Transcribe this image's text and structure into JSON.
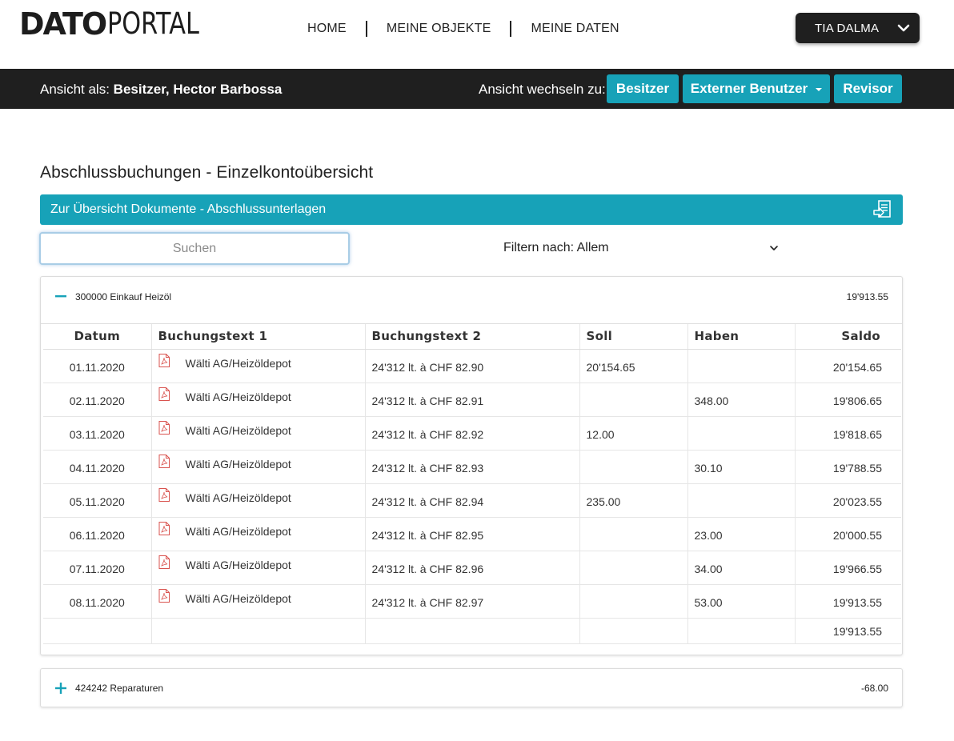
{
  "brand": {
    "logo_bold": "DATO",
    "logo_light": "PORTAL"
  },
  "nav": {
    "items": [
      {
        "label": "HOME"
      },
      {
        "label": "MEINE OBJEKTE"
      },
      {
        "label": "MEINE DATEN"
      }
    ]
  },
  "user": {
    "name": "TIA DALMA",
    "icon": "chevron-down-icon"
  },
  "viewbar": {
    "as_view_prefix": "Ansicht als:",
    "as_view_value": "Besitzer, Hector Barbossa",
    "switch_label": "Ansicht wechseln zu:",
    "buttons": [
      {
        "label": "Besitzer"
      },
      {
        "label": "Externer Benutzer"
      },
      {
        "label": "Revisor"
      }
    ]
  },
  "page": {
    "title": "Abschlussbuchungen - Einzelkontoübersicht",
    "doc_link": "Zur Übersicht Dokumente - Abschlussunterlagen",
    "doc_icon": "document-arrow-icon"
  },
  "search": {
    "placeholder": "Suchen",
    "value": ""
  },
  "filter": {
    "label": "Filtern nach: Allem"
  },
  "accent_color": "#17a2b8",
  "accounts": [
    {
      "name": "300000 Einkauf Heizöl",
      "total": "19'913.55",
      "expanded": true,
      "columns": [
        "Datum",
        "Buchungstext 1",
        "Buchungstext 2",
        "Soll",
        "Haben",
        "Saldo"
      ],
      "rows": [
        {
          "date": "01.11.2020",
          "text1": "Wälti AG/Heizöldepot",
          "text2": "24'312 lt. à CHF 82.90",
          "soll": "20'154.65",
          "haben": "",
          "saldo": "20'154.65"
        },
        {
          "date": "02.11.2020",
          "text1": "Wälti AG/Heizöldepot",
          "text2": "24'312 lt. à CHF 82.91",
          "soll": "",
          "haben": "348.00",
          "saldo": "19'806.65"
        },
        {
          "date": "03.11.2020",
          "text1": "Wälti AG/Heizöldepot",
          "text2": "24'312 lt. à CHF 82.92",
          "soll": "12.00",
          "haben": "",
          "saldo": "19'818.65"
        },
        {
          "date": "04.11.2020",
          "text1": "Wälti AG/Heizöldepot",
          "text2": "24'312 lt. à CHF 82.93",
          "soll": "",
          "haben": "30.10",
          "saldo": "19'788.55"
        },
        {
          "date": "05.11.2020",
          "text1": "Wälti AG/Heizöldepot",
          "text2": "24'312 lt. à CHF 82.94",
          "soll": "235.00",
          "haben": "",
          "saldo": "20'023.55"
        },
        {
          "date": "06.11.2020",
          "text1": "Wälti AG/Heizöldepot",
          "text2": "24'312 lt. à CHF 82.95",
          "soll": "",
          "haben": "23.00",
          "saldo": "20'000.55"
        },
        {
          "date": "07.11.2020",
          "text1": "Wälti AG/Heizöldepot",
          "text2": "24'312 lt. à CHF 82.96",
          "soll": "",
          "haben": "34.00",
          "saldo": "19'966.55"
        },
        {
          "date": "08.11.2020",
          "text1": "Wälti AG/Heizöldepot",
          "text2": "24'312 lt. à CHF 82.97",
          "soll": "",
          "haben": "53.00",
          "saldo": "19'913.55"
        }
      ],
      "closing_saldo": "19'913.55"
    },
    {
      "name": "424242 Reparaturen",
      "total": "-68.00",
      "expanded": false
    }
  ]
}
